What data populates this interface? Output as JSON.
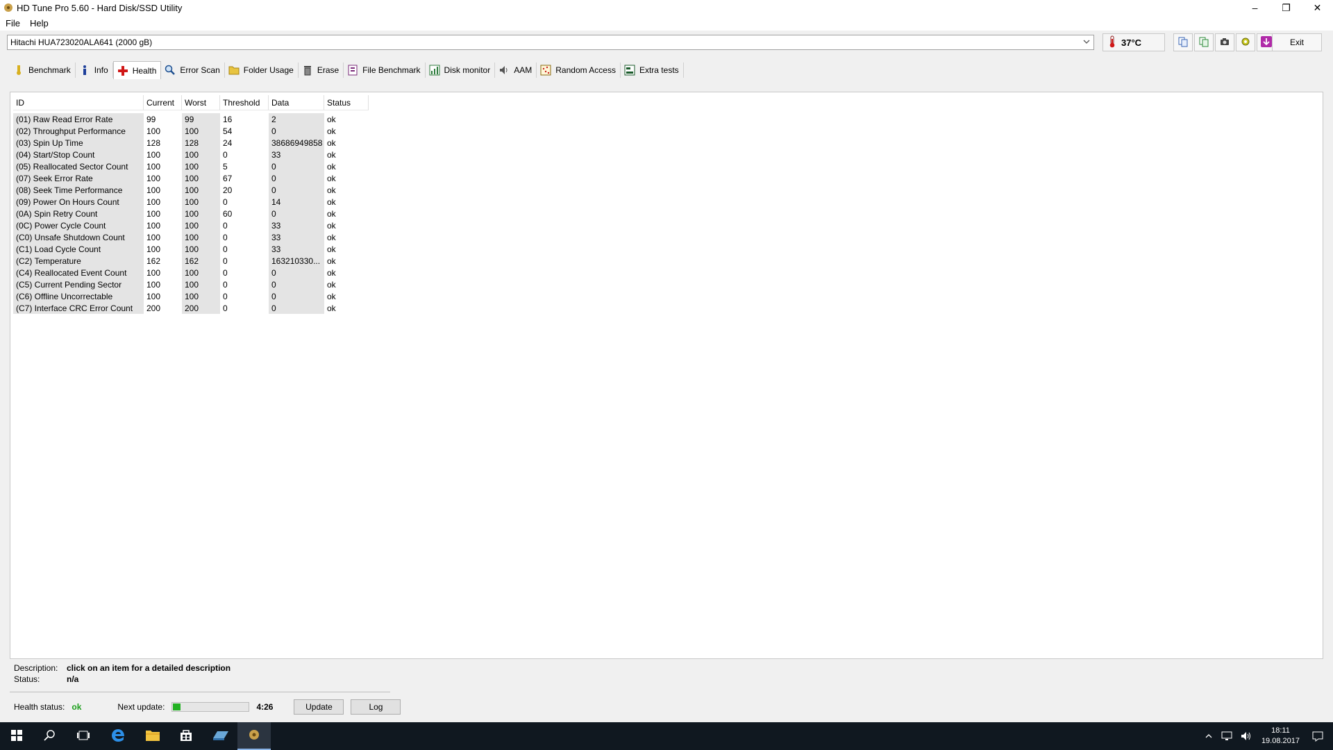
{
  "window": {
    "title": "HD Tune Pro 5.60 - Hard Disk/SSD Utility",
    "minimize": "–",
    "restore": "❐",
    "close": "✕"
  },
  "menu": {
    "file": "File",
    "help": "Help"
  },
  "toolbar": {
    "drive": "Hitachi HUA723020ALA641 (2000 gB)",
    "temperature": "37°C",
    "exit": "Exit"
  },
  "tabs": [
    {
      "label": "Benchmark",
      "icon": "benchmark-icon"
    },
    {
      "label": "Info",
      "icon": "info-icon"
    },
    {
      "label": "Health",
      "icon": "health-icon"
    },
    {
      "label": "Error Scan",
      "icon": "error-scan-icon"
    },
    {
      "label": "Folder Usage",
      "icon": "folder-icon"
    },
    {
      "label": "Erase",
      "icon": "erase-icon"
    },
    {
      "label": "File Benchmark",
      "icon": "file-benchmark-icon"
    },
    {
      "label": "Disk monitor",
      "icon": "disk-monitor-icon"
    },
    {
      "label": "AAM",
      "icon": "speaker-icon"
    },
    {
      "label": "Random Access",
      "icon": "random-access-icon"
    },
    {
      "label": "Extra tests",
      "icon": "extra-tests-icon"
    }
  ],
  "active_tab": "Health",
  "table": {
    "headers": [
      "ID",
      "Current",
      "Worst",
      "Threshold",
      "Data",
      "Status"
    ],
    "rows": [
      [
        "(01) Raw Read Error Rate",
        "99",
        "99",
        "16",
        "2",
        "ok"
      ],
      [
        "(02) Throughput Performance",
        "100",
        "100",
        "54",
        "0",
        "ok"
      ],
      [
        "(03) Spin Up Time",
        "128",
        "128",
        "24",
        "38686949858",
        "ok"
      ],
      [
        "(04) Start/Stop Count",
        "100",
        "100",
        "0",
        "33",
        "ok"
      ],
      [
        "(05) Reallocated Sector Count",
        "100",
        "100",
        "5",
        "0",
        "ok"
      ],
      [
        "(07) Seek Error Rate",
        "100",
        "100",
        "67",
        "0",
        "ok"
      ],
      [
        "(08) Seek Time Performance",
        "100",
        "100",
        "20",
        "0",
        "ok"
      ],
      [
        "(09) Power On Hours Count",
        "100",
        "100",
        "0",
        "14",
        "ok"
      ],
      [
        "(0A) Spin Retry Count",
        "100",
        "100",
        "60",
        "0",
        "ok"
      ],
      [
        "(0C) Power Cycle Count",
        "100",
        "100",
        "0",
        "33",
        "ok"
      ],
      [
        "(C0) Unsafe Shutdown Count",
        "100",
        "100",
        "0",
        "33",
        "ok"
      ],
      [
        "(C1) Load Cycle Count",
        "100",
        "100",
        "0",
        "33",
        "ok"
      ],
      [
        "(C2) Temperature",
        "162",
        "162",
        "0",
        "163210330...",
        "ok"
      ],
      [
        "(C4) Reallocated Event Count",
        "100",
        "100",
        "0",
        "0",
        "ok"
      ],
      [
        "(C5) Current Pending Sector",
        "100",
        "100",
        "0",
        "0",
        "ok"
      ],
      [
        "(C6) Offline Uncorrectable",
        "100",
        "100",
        "0",
        "0",
        "ok"
      ],
      [
        "(C7) Interface CRC Error Count",
        "200",
        "200",
        "0",
        "0",
        "ok"
      ]
    ]
  },
  "details": {
    "description_label": "Description:",
    "description_value": "click on an item for a detailed description",
    "status_label": "Status:",
    "status_value": "n/a"
  },
  "footer": {
    "health_status_label": "Health status:",
    "health_status_value": "ok",
    "next_update_label": "Next update:",
    "next_update_progress": 0.1,
    "next_update_time": "4:26",
    "update_button": "Update",
    "log_button": "Log"
  },
  "colors": {
    "ok_green": "#1a9e1a",
    "progress_green": "#22b122",
    "taskbar": "#101820"
  },
  "taskbar": {
    "time": "18:11",
    "date": "19.08.2017"
  }
}
